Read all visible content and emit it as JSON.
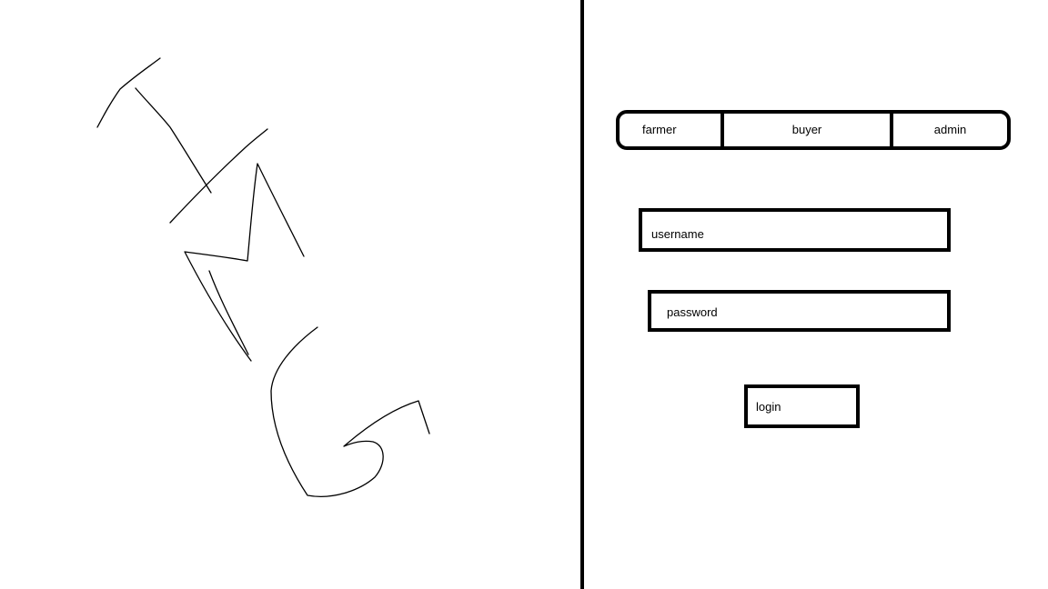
{
  "image_placeholder": {
    "letters": [
      "I",
      "M",
      "G"
    ],
    "icon": "hand-drawn-img-placeholder"
  },
  "role_tabs": [
    {
      "label": "farmer"
    },
    {
      "label": "buyer"
    },
    {
      "label": "admin"
    }
  ],
  "login_form": {
    "username_placeholder": "username",
    "password_placeholder": "password",
    "login_label": "login"
  },
  "colors": {
    "background": "#ffffff",
    "ink": "#000000"
  }
}
